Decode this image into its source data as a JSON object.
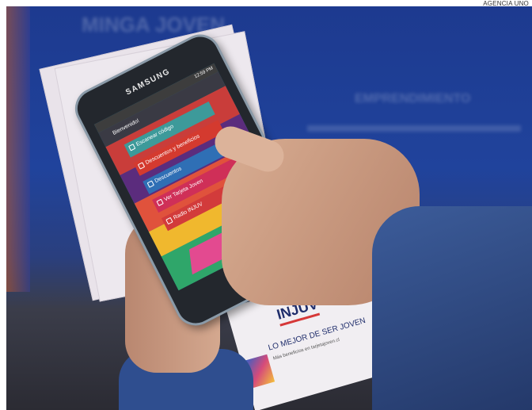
{
  "photo_credit": "AGENCIA UNO",
  "background_text": {
    "line1": "MINGA JOVEN",
    "line2": "EMPRENDIMIENTO"
  },
  "phone": {
    "brand": "SAMSUNG",
    "status_time": "12:59 PM",
    "app_greeting": "Bienvenido!",
    "menu": [
      {
        "label": "Escanear código",
        "color": "#3d9a9a"
      },
      {
        "label": "Descuentos y beneficios",
        "color": "#d43a2f"
      },
      {
        "label": "Descuentos",
        "color": "#2f6fb5"
      },
      {
        "label": "Ver Tarjeta Joven",
        "color": "#cf2f58"
      },
      {
        "label": "Radio INJUV",
        "color": "#d23b3b"
      }
    ]
  },
  "leaflet": {
    "logo": "INJUV",
    "tagline": "LO MEJOR DE SER JOVEN",
    "small_text": "Más beneficios en tarjetajoven.cl"
  }
}
